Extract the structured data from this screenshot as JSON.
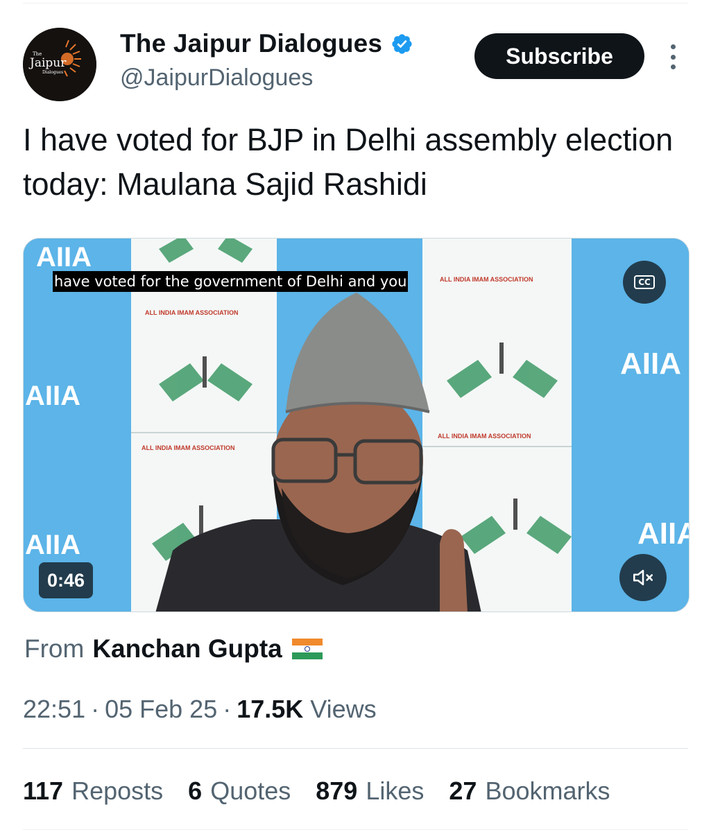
{
  "account": {
    "name": "The Jaipur Dialogues",
    "handle": "@JaipurDialogues",
    "verified": true,
    "avatar_icon": "jaipur-dialogues-logo",
    "avatar_text_small": "The",
    "avatar_text_main": "Jaipur",
    "avatar_text_sub": "Dialogues"
  },
  "header": {
    "subscribe_label": "Subscribe",
    "more_icon": "more-vertical-icon"
  },
  "tweet": {
    "text": "I have voted for BJP in Delhi assembly election today: Maulana Sajid Rashidi"
  },
  "video": {
    "caption": "have voted for the government of Delhi and you",
    "duration": "0:46",
    "cc_label": "CC",
    "mute_icon": "volume-muted-icon",
    "backdrop_words": {
      "abbr": "AIIA",
      "org": "ALL INDIA IMAM ASSOCIATION"
    }
  },
  "attribution": {
    "prefix": "From",
    "name": "Kanchan Gupta",
    "flag_icon": "india-flag-icon"
  },
  "meta": {
    "time": "22:51",
    "separator": "·",
    "date": "05 Feb 25",
    "views_count": "17.5K",
    "views_label": "Views"
  },
  "stats": [
    {
      "count": "117",
      "label": "Reposts"
    },
    {
      "count": "6",
      "label": "Quotes"
    },
    {
      "count": "879",
      "label": "Likes"
    },
    {
      "count": "27",
      "label": "Bookmarks"
    }
  ],
  "colors": {
    "text_primary": "#0f1419",
    "text_secondary": "#536471",
    "verified_blue": "#1d9bf0",
    "backdrop_blue": "#5cb4e8",
    "flag_green": "#2e9a5a"
  }
}
